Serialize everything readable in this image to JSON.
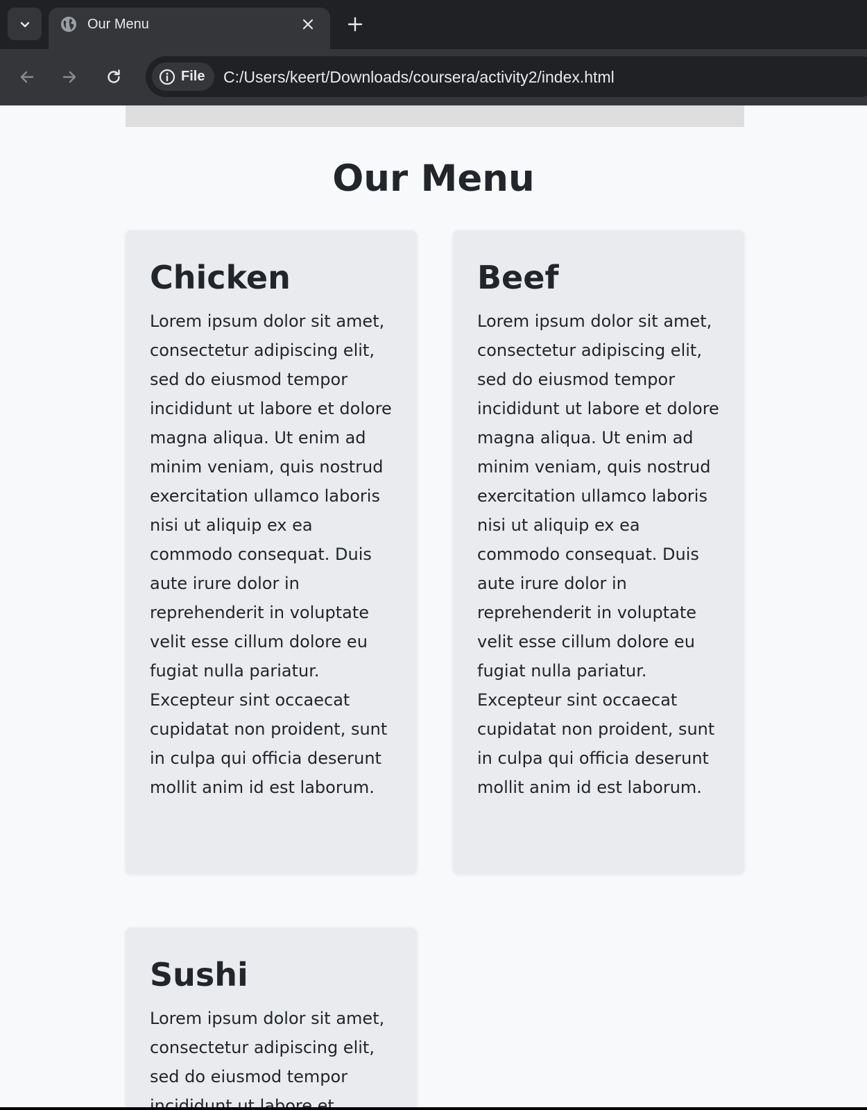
{
  "browser": {
    "tab_title": "Our Menu",
    "site_chip_label": "File",
    "url": "C:/Users/keert/Downloads/coursera/activity2/index.html"
  },
  "page": {
    "title": "Our Menu",
    "cards": [
      {
        "title": "Chicken",
        "text": "Lorem ipsum dolor sit amet, consectetur adipiscing elit, sed do eiusmod tempor incididunt ut labore et dolore magna aliqua. Ut enim ad minim veniam, quis nostrud exercitation ullamco laboris nisi ut aliquip ex ea commodo consequat. Duis aute irure dolor in reprehenderit in voluptate velit esse cillum dolore eu fugiat nulla pariatur. Excepteur sint occaecat cupidatat non proident, sunt in culpa qui officia deserunt mollit anim id est laborum."
      },
      {
        "title": "Beef",
        "text": "Lorem ipsum dolor sit amet, consectetur adipiscing elit, sed do eiusmod tempor incididunt ut labore et dolore magna aliqua. Ut enim ad minim veniam, quis nostrud exercitation ullamco laboris nisi ut aliquip ex ea commodo consequat. Duis aute irure dolor in reprehenderit in voluptate velit esse cillum dolore eu fugiat nulla pariatur. Excepteur sint occaecat cupidatat non proident, sunt in culpa qui officia deserunt mollit anim id est laborum."
      },
      {
        "title": "Sushi",
        "text": "Lorem ipsum dolor sit amet, consectetur adipiscing elit, sed do eiusmod tempor incididunt ut labore et"
      }
    ]
  },
  "icons": {
    "tab_search": "chevron-down-icon",
    "favicon": "globe-icon",
    "tab_close": "close-icon",
    "new_tab": "plus-icon",
    "back": "arrow-left-icon",
    "forward": "arrow-right-icon",
    "reload": "reload-icon",
    "site_info": "info-icon"
  },
  "colors": {
    "chrome_bg": "#202124",
    "tab_active_bg": "#35363a",
    "page_bg": "#f8f9fb",
    "card_bg": "#e9ebee",
    "text": "#222529"
  }
}
